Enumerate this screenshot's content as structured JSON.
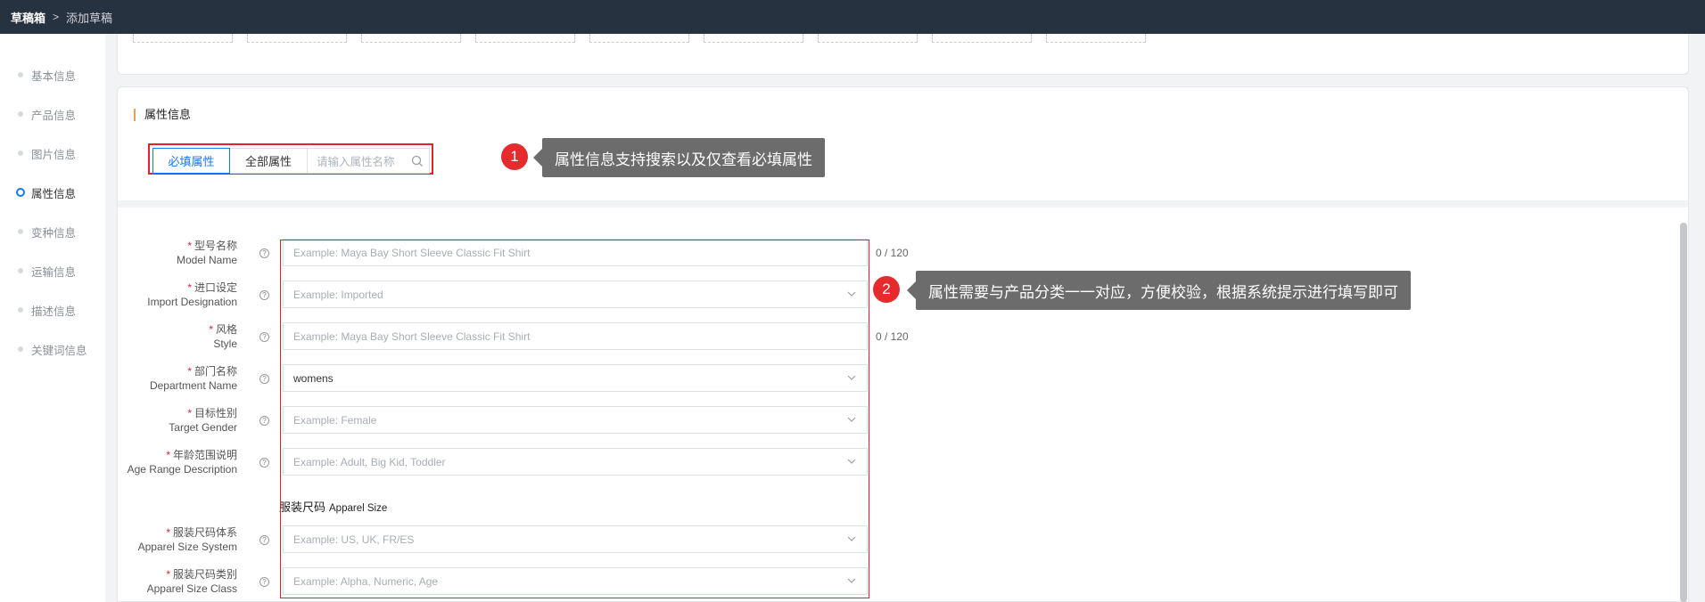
{
  "breadcrumb": {
    "root": "草稿箱",
    "separator": ">",
    "current": "添加草稿"
  },
  "sidenav": {
    "items": [
      {
        "label": "基本信息",
        "active": false
      },
      {
        "label": "产品信息",
        "active": false
      },
      {
        "label": "图片信息",
        "active": false
      },
      {
        "label": "属性信息",
        "active": true
      },
      {
        "label": "变种信息",
        "active": false
      },
      {
        "label": "运输信息",
        "active": false
      },
      {
        "label": "描述信息",
        "active": false
      },
      {
        "label": "关键词信息",
        "active": false
      }
    ]
  },
  "attributes": {
    "section_title": "属性信息",
    "filter": {
      "required_label": "必填属性",
      "all_label": "全部属性",
      "search_placeholder": "请输入属性名称"
    },
    "annotations": [
      {
        "number": "1",
        "text": "属性信息支持搜索以及仅查看必填属性"
      },
      {
        "number": "2",
        "text": "属性需要与产品分类一一对应，方便校验，根据系统提示进行填写即可"
      }
    ],
    "fields": [
      {
        "label_cn": "型号名称",
        "label_en": "Model Name",
        "required": true,
        "value": "",
        "placeholder": "Example: Maya Bay Short Sleeve Classic Fit Shirt",
        "type": "text",
        "counter": "0 / 120"
      },
      {
        "label_cn": "进口设定",
        "label_en": "Import Designation",
        "required": true,
        "value": "",
        "placeholder": "Example: Imported",
        "type": "select"
      },
      {
        "label_cn": "风格",
        "label_en": "Style",
        "required": true,
        "value": "",
        "placeholder": "Example: Maya Bay Short Sleeve Classic Fit Shirt",
        "type": "text",
        "counter": "0 / 120"
      },
      {
        "label_cn": "部门名称",
        "label_en": "Department Name",
        "required": true,
        "value": "womens",
        "placeholder": "",
        "type": "select"
      },
      {
        "label_cn": "目标性别",
        "label_en": "Target Gender",
        "required": true,
        "value": "",
        "placeholder": "Example: Female",
        "type": "select"
      },
      {
        "label_cn": "年龄范围说明",
        "label_en": "Age Range Description",
        "required": true,
        "value": "",
        "placeholder": "Example: Adult, Big Kid, Toddler",
        "type": "select"
      }
    ],
    "group": {
      "title_cn": "服装尺码",
      "title_en": "Apparel Size"
    },
    "group_fields": [
      {
        "label_cn": "服装尺码体系",
        "label_en": "Apparel Size System",
        "required": true,
        "value": "",
        "placeholder": "Example: US, UK, FR/ES",
        "type": "select"
      },
      {
        "label_cn": "服装尺码类别",
        "label_en": "Apparel Size Class",
        "required": true,
        "value": "",
        "placeholder": "Example: Alpha, Numeric, Age",
        "type": "select"
      }
    ]
  },
  "colors": {
    "topbar": "#273240",
    "accent": "#1677ff",
    "highlight_red": "#e0242a",
    "tooltip_bg": "#6c6c6c"
  },
  "icons": [
    "search-icon",
    "chevron-down-icon",
    "help-icon"
  ]
}
